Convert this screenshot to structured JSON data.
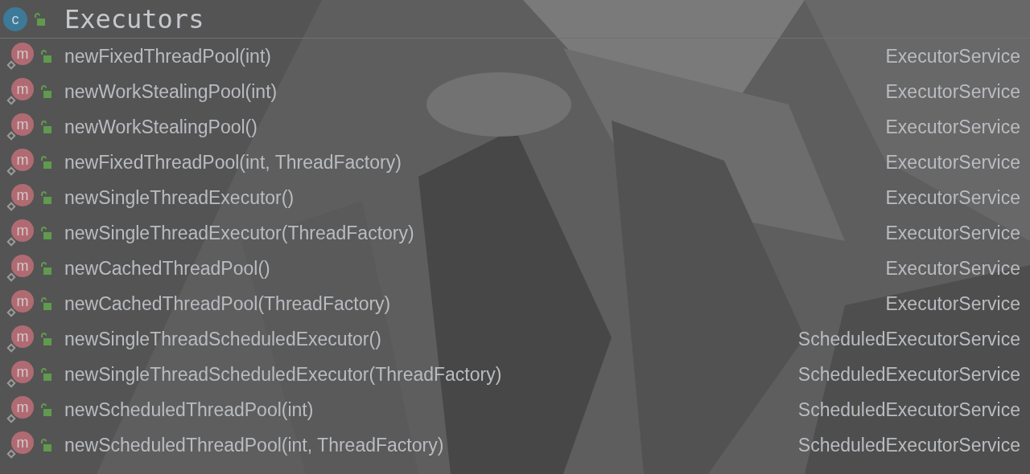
{
  "header": {
    "badge": "c",
    "title": "Executors"
  },
  "members": [
    {
      "badge": "m",
      "name": "newFixedThreadPool(int)",
      "type": "ExecutorService"
    },
    {
      "badge": "m",
      "name": "newWorkStealingPool(int)",
      "type": "ExecutorService"
    },
    {
      "badge": "m",
      "name": "newWorkStealingPool()",
      "type": "ExecutorService"
    },
    {
      "badge": "m",
      "name": "newFixedThreadPool(int, ThreadFactory)",
      "type": "ExecutorService"
    },
    {
      "badge": "m",
      "name": "newSingleThreadExecutor()",
      "type": "ExecutorService"
    },
    {
      "badge": "m",
      "name": "newSingleThreadExecutor(ThreadFactory)",
      "type": "ExecutorService"
    },
    {
      "badge": "m",
      "name": "newCachedThreadPool()",
      "type": "ExecutorService"
    },
    {
      "badge": "m",
      "name": "newCachedThreadPool(ThreadFactory)",
      "type": "ExecutorService"
    },
    {
      "badge": "m",
      "name": "newSingleThreadScheduledExecutor()",
      "type": "ScheduledExecutorService"
    },
    {
      "badge": "m",
      "name": "newSingleThreadScheduledExecutor(ThreadFactory)",
      "type": "ScheduledExecutorService"
    },
    {
      "badge": "m",
      "name": "newScheduledThreadPool(int)",
      "type": "ScheduledExecutorService"
    },
    {
      "badge": "m",
      "name": "newScheduledThreadPool(int, ThreadFactory)",
      "type": "ScheduledExecutorService"
    }
  ]
}
